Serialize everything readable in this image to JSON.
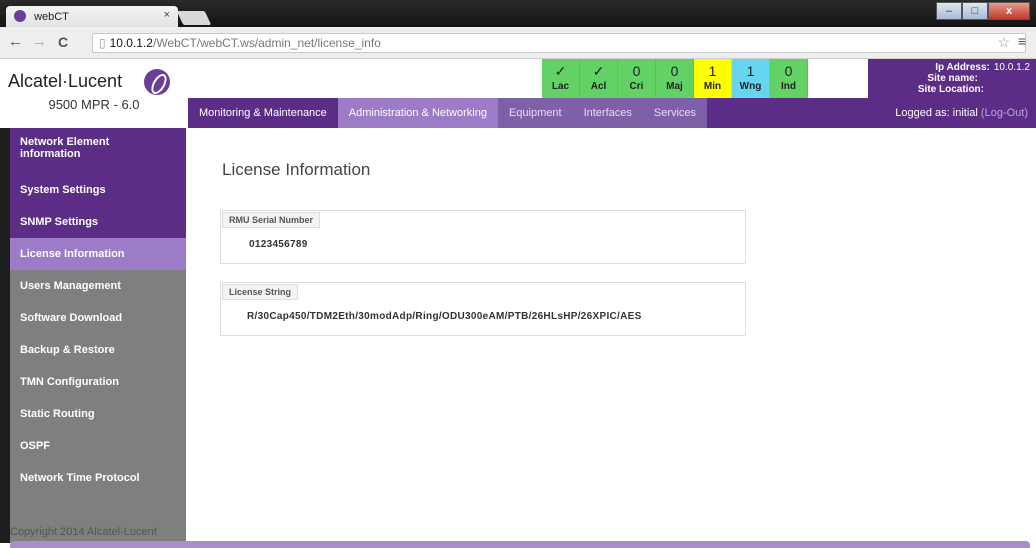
{
  "browser": {
    "tab_title": "webCT",
    "tab_close": "×",
    "url_host": "10.0.1.2",
    "url_path": "/WebCT/webCT.ws/admin_net/license_info",
    "back": "←",
    "forward": "→",
    "reload": "C",
    "star": "☆",
    "menu": "≡",
    "win_min": "–",
    "win_max": "□",
    "win_close": "x"
  },
  "header": {
    "brand": "Alcatel·Lucent",
    "model": "9500 MPR - 6.0",
    "alarms": [
      {
        "value": "✓",
        "key": "Lac",
        "color": "#62d266"
      },
      {
        "value": "✓",
        "key": "Acl",
        "color": "#62d266"
      },
      {
        "value": "0",
        "key": "Cri",
        "color": "#62d266"
      },
      {
        "value": "0",
        "key": "Maj",
        "color": "#62d266"
      },
      {
        "value": "1",
        "key": "Min",
        "color": "#ffff00"
      },
      {
        "value": "1",
        "key": "Wng",
        "color": "#66d5ef"
      },
      {
        "value": "0",
        "key": "Ind",
        "color": "#62d266"
      }
    ],
    "ip_label": "Ip Address:",
    "ip_value": "10.0.1.2",
    "site_name_label": "Site name:",
    "site_location_label": "Site Location:"
  },
  "menu": {
    "items": [
      "Monitoring & Maintenance",
      "Administration & Networking",
      "Equipment",
      "Interfaces",
      "Services"
    ],
    "logged_as": "Logged as: initial",
    "logout": "(Log-Out)"
  },
  "sidebar": {
    "items": [
      "Network Element information",
      "System Settings",
      "SNMP Settings",
      "License Information",
      "Users Management",
      "Software Download",
      "Backup & Restore",
      "TMN Configuration",
      "Static Routing",
      "OSPF",
      "Network Time Protocol"
    ]
  },
  "main": {
    "title": "License Information",
    "rmu_label": "RMU Serial Number",
    "rmu_value": "0123456789",
    "license_label": "License String",
    "license_value": "R/30Cap450/TDM2Eth/30modAdp/Ring/ODU300eAM/PTB/26HLsHP/26XPIC/AES"
  },
  "footer": {
    "copyright": "Copyright 2014 Alcatel-Lucent"
  },
  "colors": {
    "purple": "#5b2d86",
    "purple_active": "#9c7cc6",
    "sidebar_gray": "#7f7f7f",
    "alarm_green": "#62d266",
    "alarm_yellow": "#ffff00",
    "alarm_cyan": "#66d5ef"
  }
}
